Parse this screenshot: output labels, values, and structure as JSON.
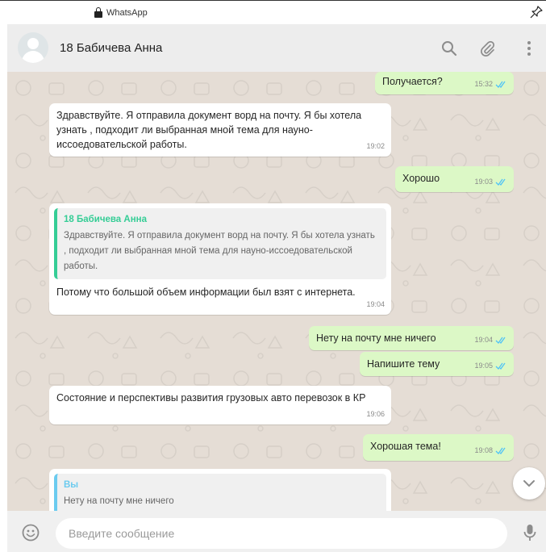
{
  "window": {
    "title": "WhatsApp",
    "icons": [
      "lock-icon",
      "pin-icon"
    ]
  },
  "header": {
    "contact_name": "18 Бабичева Анна",
    "icons": [
      "avatar",
      "search-icon",
      "paperclip-icon",
      "menu-icon"
    ]
  },
  "messages": [
    {
      "id": "m1",
      "direction": "out",
      "text": "Получается?",
      "time": "15:32",
      "read": true
    },
    {
      "id": "m2",
      "direction": "in",
      "text": "Здравствуйте. Я отправила документ ворд на почту. Я бы хотела узнать , подходит ли выбранная мной тема для науно-иссоедовательской работы.",
      "time": "19:02"
    },
    {
      "id": "m3",
      "direction": "out",
      "text": "Хорошо",
      "time": "19:03",
      "read": true
    },
    {
      "id": "m4",
      "direction": "in",
      "quote": {
        "author": "18 Бабичева Анна",
        "text": "Здравствуйте. Я отправила документ ворд на почту. Я бы хотела узнать , подходит ли выбранная мной тема для науно-иссоедовательской работы."
      },
      "text": "Потому что большой объем информации был взят с интернета.",
      "time": "19:04"
    },
    {
      "id": "m5",
      "direction": "out",
      "text": "Нету на почту мне ничего",
      "time": "19:04",
      "read": true
    },
    {
      "id": "m6",
      "direction": "out",
      "text": "Напишите тему",
      "time": "19:05",
      "read": true
    },
    {
      "id": "m7",
      "direction": "in",
      "text": "Состояние и перспективы развития грузовых авто перевозок в КР",
      "time": "19:06"
    },
    {
      "id": "m8",
      "direction": "out",
      "text": "Хорошая тема!",
      "time": "19:08",
      "read": true
    },
    {
      "id": "m9",
      "direction": "in",
      "quote": {
        "author": "Вы",
        "text": "Нету на почту мне ничего"
      },
      "text": "",
      "time": ""
    }
  ],
  "composer": {
    "placeholder": "Введите сообщение",
    "value": "",
    "icons": [
      "emoji-icon",
      "microphone-icon"
    ]
  },
  "colors": {
    "chat_background": "#e5ddd5",
    "outgoing_bubble": "#dcf8c6",
    "incoming_bubble": "#ffffff",
    "read_ticks": "#4fc3f7",
    "quote_bar_contact": "#35cd96",
    "quote_bar_self": "#6bcbef"
  }
}
